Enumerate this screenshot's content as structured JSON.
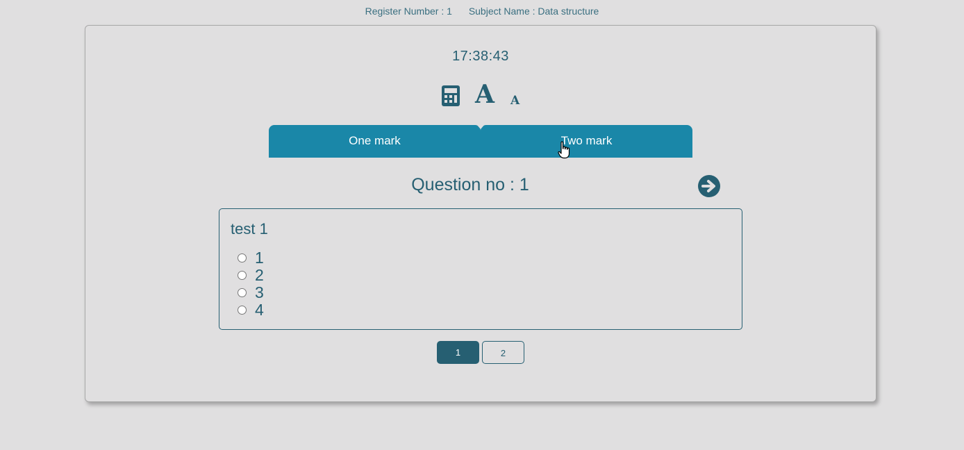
{
  "header": {
    "register_number": "Register Number : 1",
    "subject_name": "Subject Name : Data structure"
  },
  "timer": {
    "time": "17:38:43"
  },
  "toolbar": {
    "calculator_icon": "calculator-icon",
    "font_increase_label": "A",
    "font_decrease_label": "A"
  },
  "tabs": [
    {
      "label": "One mark",
      "active": false
    },
    {
      "label": "Two mark",
      "active": true
    }
  ],
  "question": {
    "title": "Question no : 1",
    "text": "test 1",
    "options": [
      "1",
      "2",
      "3",
      "4"
    ],
    "next_icon": "arrow-right-circle-icon"
  },
  "pagination": {
    "pages": [
      "1",
      "2"
    ],
    "current": "1"
  },
  "colors": {
    "background": "#e0dfe0",
    "primary": "#265f72",
    "tab": "#1a87a8"
  }
}
